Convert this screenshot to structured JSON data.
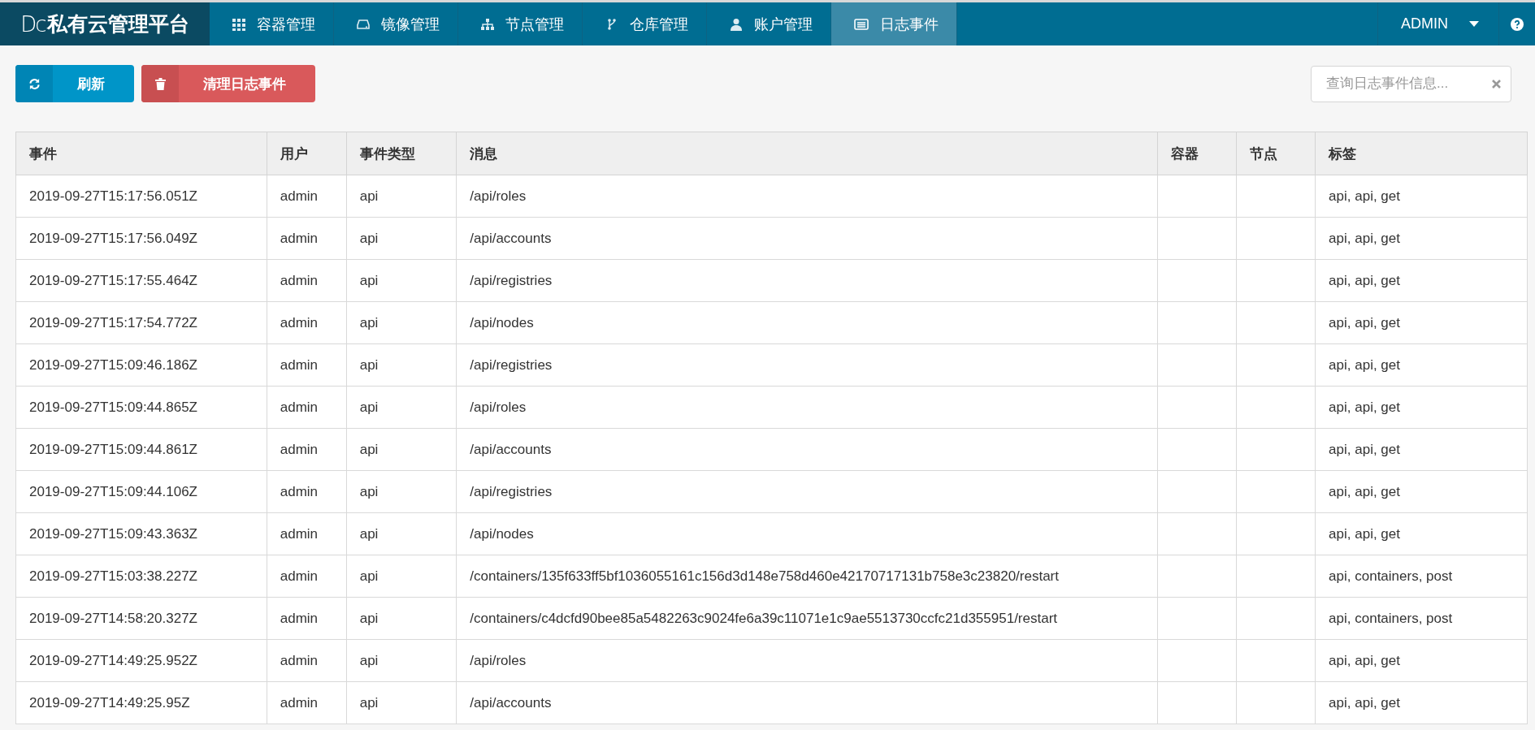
{
  "brand": {
    "mark": "Dc",
    "name": "私有云管理平台"
  },
  "nav": [
    {
      "label": "容器管理",
      "selected": false
    },
    {
      "label": "镜像管理",
      "selected": false
    },
    {
      "label": "节点管理",
      "selected": false
    },
    {
      "label": "仓库管理",
      "selected": false
    },
    {
      "label": "账户管理",
      "selected": false
    },
    {
      "label": "日志事件",
      "selected": true
    }
  ],
  "user_menu": {
    "label": "ADMIN"
  },
  "toolbar": {
    "refresh": "刷新",
    "clear": "清理日志事件"
  },
  "search": {
    "placeholder": "查询日志事件信息..."
  },
  "table": {
    "columns": [
      "事件",
      "用户",
      "事件类型",
      "消息",
      "容器",
      "节点",
      "标签"
    ],
    "rows": [
      [
        "2019-09-27T15:17:56.051Z",
        "admin",
        "api",
        "/api/roles",
        "",
        "",
        "api, api, get"
      ],
      [
        "2019-09-27T15:17:56.049Z",
        "admin",
        "api",
        "/api/accounts",
        "",
        "",
        "api, api, get"
      ],
      [
        "2019-09-27T15:17:55.464Z",
        "admin",
        "api",
        "/api/registries",
        "",
        "",
        "api, api, get"
      ],
      [
        "2019-09-27T15:17:54.772Z",
        "admin",
        "api",
        "/api/nodes",
        "",
        "",
        "api, api, get"
      ],
      [
        "2019-09-27T15:09:46.186Z",
        "admin",
        "api",
        "/api/registries",
        "",
        "",
        "api, api, get"
      ],
      [
        "2019-09-27T15:09:44.865Z",
        "admin",
        "api",
        "/api/roles",
        "",
        "",
        "api, api, get"
      ],
      [
        "2019-09-27T15:09:44.861Z",
        "admin",
        "api",
        "/api/accounts",
        "",
        "",
        "api, api, get"
      ],
      [
        "2019-09-27T15:09:44.106Z",
        "admin",
        "api",
        "/api/registries",
        "",
        "",
        "api, api, get"
      ],
      [
        "2019-09-27T15:09:43.363Z",
        "admin",
        "api",
        "/api/nodes",
        "",
        "",
        "api, api, get"
      ],
      [
        "2019-09-27T15:03:38.227Z",
        "admin",
        "api",
        "/containers/135f633ff5bf1036055161c156d3d148e758d460e42170717131b758e3c23820/restart",
        "",
        "",
        "api, containers, post"
      ],
      [
        "2019-09-27T14:58:20.327Z",
        "admin",
        "api",
        "/containers/c4dcfd90bee85a5482263c9024fe6a39c11071e1c9ae5513730ccfc21d355951/restart",
        "",
        "",
        "api, containers, post"
      ],
      [
        "2019-09-27T14:49:25.952Z",
        "admin",
        "api",
        "/api/roles",
        "",
        "",
        "api, api, get"
      ],
      [
        "2019-09-27T14:49:25.95Z",
        "admin",
        "api",
        "/api/accounts",
        "",
        "",
        "api, api, get"
      ]
    ]
  }
}
